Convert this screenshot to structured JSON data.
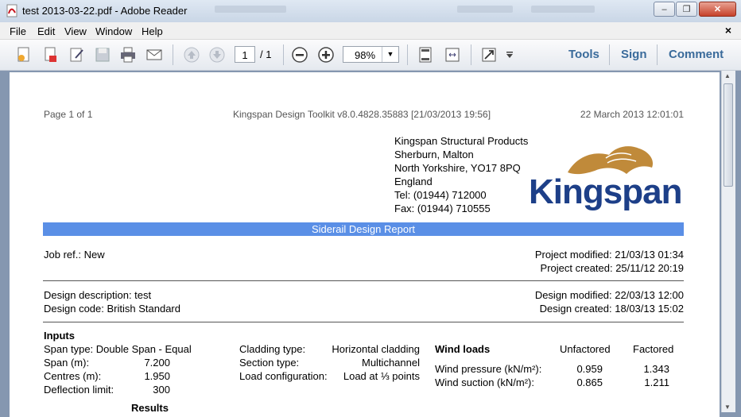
{
  "window": {
    "title": "test 2013-03-22.pdf - Adobe Reader",
    "controls": {
      "minimize": "–",
      "restore": "❐",
      "close": "✕"
    }
  },
  "menu": {
    "items": [
      "File",
      "Edit",
      "View",
      "Window",
      "Help"
    ],
    "close": "×"
  },
  "toolbar": {
    "page_current": "1",
    "page_total": "/ 1",
    "zoom": "98%",
    "links": {
      "tools": "Tools",
      "sign": "Sign",
      "comment": "Comment"
    }
  },
  "document": {
    "header": {
      "page": "Page 1 of 1",
      "toolkit": "Kingspan Design Toolkit v8.0.4828.35883 [21/03/2013 19:56]",
      "date": "22 March 2013 12:01:01"
    },
    "address": [
      "Kingspan Structural Products",
      "Sherburn, Malton",
      "North Yorkshire, YO17 8PQ",
      "England",
      "Tel: (01944) 712000",
      "Fax: (01944) 710555"
    ],
    "logo_text": "Kingspan",
    "report_title": "Siderail Design Report",
    "job_ref": "Job ref.: New",
    "project_modified": "Project modified: 21/03/13 01:34",
    "project_created": "Project created: 25/11/12 20:19",
    "design_description": "Design description: test",
    "design_code": "Design code:  British Standard",
    "design_modified": "Design modified: 22/03/13 12:00",
    "design_created": "Design created: 18/03/13 15:02",
    "inputs": {
      "heading": "Inputs",
      "span_type": "Span type:  Double Span - Equal",
      "rows": [
        {
          "label": "Span (m):",
          "value": "7.200"
        },
        {
          "label": "Centres (m):",
          "value": "1.950"
        },
        {
          "label": "Deflection limit:",
          "value": "300"
        }
      ],
      "middle": [
        {
          "label": "Cladding type:",
          "value": "Horizontal cladding"
        },
        {
          "label": "Section type:",
          "value": "Multichannel"
        },
        {
          "label": "Load configuration:",
          "value": "Load at ⅓ points"
        }
      ]
    },
    "wind": {
      "heading": "Wind loads",
      "col1": "Unfactored",
      "col2": "Factored",
      "rows": [
        {
          "label": "Wind pressure (kN/m²):",
          "unfactored": "0.959",
          "factored": "1.343"
        },
        {
          "label": "Wind suction (kN/m²):",
          "unfactored": "0.865",
          "factored": "1.211"
        }
      ]
    },
    "results_heading": "Results"
  },
  "colors": {
    "band": "#5a8fe6",
    "logo_blue": "#1d3f88",
    "logo_gold": "#c08a3a",
    "link": "#3a6b9b"
  }
}
